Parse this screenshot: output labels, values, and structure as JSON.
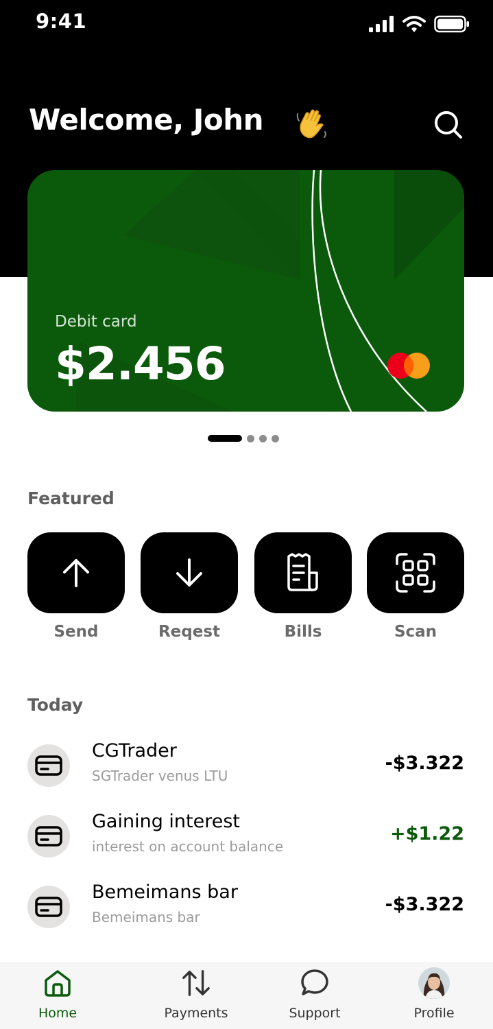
{
  "status_bar": {
    "time": "9:41"
  },
  "header": {
    "welcome": "Welcome, John",
    "emoji": "waving-hand-icon"
  },
  "card": {
    "label": "Debit card",
    "balance": "$2.456",
    "brand": "mastercard-logo",
    "color": "#0b5a0b"
  },
  "pager": {
    "count": 4,
    "active": 0
  },
  "featured": {
    "title": "Featured",
    "actions": [
      {
        "label": "Send",
        "icon": "arrow-up-icon"
      },
      {
        "label": "Reqest",
        "icon": "arrow-down-icon"
      },
      {
        "label": "Bills",
        "icon": "receipt-icon"
      },
      {
        "label": "Scan",
        "icon": "qr-scan-icon"
      }
    ]
  },
  "today": {
    "title": "Today",
    "transactions": [
      {
        "title": "CGTrader",
        "subtitle": "SGTrader venus LTU",
        "amount": "-$3.322",
        "type": "debit"
      },
      {
        "title": "Gaining interest",
        "subtitle": "interest on account balance",
        "amount": "+$1.22",
        "type": "credit"
      },
      {
        "title": "Bemeimans bar",
        "subtitle": "Bemeimans bar",
        "amount": "-$3.322",
        "type": "debit"
      }
    ]
  },
  "bottom_nav": {
    "items": [
      {
        "label": "Home",
        "icon": "home-icon",
        "active": true
      },
      {
        "label": "Payments",
        "icon": "arrows-up-down-icon",
        "active": false
      },
      {
        "label": "Support",
        "icon": "chat-bubble-icon",
        "active": false
      },
      {
        "label": "Profile",
        "icon": "avatar",
        "active": false
      }
    ]
  },
  "colors": {
    "accent": "#0b5a0b",
    "background": "#ffffff",
    "hero": "#000000"
  }
}
